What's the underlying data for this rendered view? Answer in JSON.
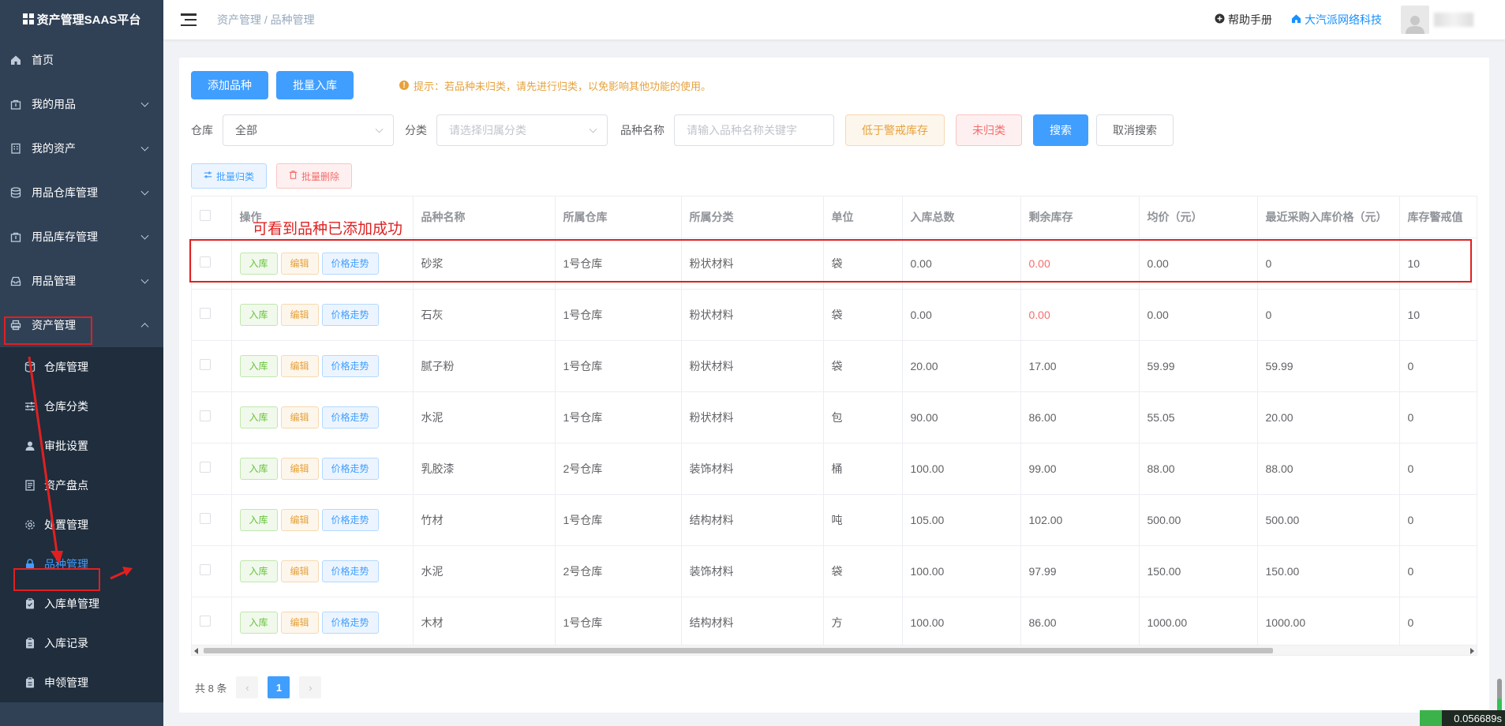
{
  "app": {
    "title": "资产管理SAAS平台"
  },
  "sidebar": {
    "items": [
      {
        "label": "首页",
        "icon": "home-icon"
      },
      {
        "label": "我的用品",
        "icon": "bag-icon"
      },
      {
        "label": "我的资产",
        "icon": "building-icon"
      },
      {
        "label": "用品仓库管理",
        "icon": "database-icon"
      },
      {
        "label": "用品库存管理",
        "icon": "bag-icon"
      },
      {
        "label": "用品管理",
        "icon": "inbox-icon"
      },
      {
        "label": "资产管理",
        "icon": "printer-icon"
      }
    ],
    "sub_items": [
      {
        "label": "仓库管理",
        "icon": "database-icon"
      },
      {
        "label": "仓库分类",
        "icon": "sliders-icon"
      },
      {
        "label": "审批设置",
        "icon": "user-icon"
      },
      {
        "label": "资产盘点",
        "icon": "document-icon"
      },
      {
        "label": "处置管理",
        "icon": "gear-icon"
      },
      {
        "label": "品种管理",
        "icon": "lock-icon"
      },
      {
        "label": "入库单管理",
        "icon": "clipboard-icon"
      },
      {
        "label": "入库记录",
        "icon": "clipboard-icon"
      },
      {
        "label": "申领管理",
        "icon": "clipboard-icon"
      }
    ]
  },
  "header": {
    "breadcrumb_parent": "资产管理",
    "breadcrumb_sep": "/",
    "breadcrumb_current": "品种管理",
    "help_label": "帮助手册",
    "company_label": "大汽派网络科技"
  },
  "toolbar": {
    "add_label": "添加品种",
    "batch_in_label": "批量入库",
    "tip": "提示：若品种未归类，请先进行归类，以免影响其他功能的使用。"
  },
  "filters": {
    "warehouse_label": "仓库",
    "warehouse_value": "全部",
    "category_label": "分类",
    "category_placeholder": "请选择归属分类",
    "name_label": "品种名称",
    "name_placeholder": "请输入品种名称关键字",
    "low_stock_label": "低于警戒库存",
    "uncategorized_label": "未归类",
    "search_label": "搜索",
    "cancel_label": "取消搜索"
  },
  "batch": {
    "classify_label": "批量归类",
    "delete_label": "批量删除"
  },
  "table": {
    "columns": [
      "操作",
      "品种名称",
      "所属仓库",
      "所属分类",
      "单位",
      "入库总数",
      "剩余库存",
      "均价（元）",
      "最近采购入库价格（元）",
      "库存警戒值"
    ],
    "action_labels": {
      "in": "入库",
      "edit": "编辑",
      "trend": "价格走势"
    },
    "rows": [
      {
        "name": "砂浆",
        "warehouse": "1号仓库",
        "category": "粉状材料",
        "unit": "袋",
        "total_in": "0.00",
        "remaining": "0.00",
        "avg_price": "0.00",
        "last_price": "0",
        "warning": "10"
      },
      {
        "name": "石灰",
        "warehouse": "1号仓库",
        "category": "粉状材料",
        "unit": "袋",
        "total_in": "0.00",
        "remaining": "0.00",
        "avg_price": "0.00",
        "last_price": "0",
        "warning": "10"
      },
      {
        "name": "腻子粉",
        "warehouse": "1号仓库",
        "category": "粉状材料",
        "unit": "袋",
        "total_in": "20.00",
        "remaining": "17.00",
        "avg_price": "59.99",
        "last_price": "59.99",
        "warning": "0"
      },
      {
        "name": "水泥",
        "warehouse": "1号仓库",
        "category": "粉状材料",
        "unit": "包",
        "total_in": "90.00",
        "remaining": "86.00",
        "avg_price": "55.05",
        "last_price": "20.00",
        "warning": "0"
      },
      {
        "name": "乳胶漆",
        "warehouse": "2号仓库",
        "category": "装饰材料",
        "unit": "桶",
        "total_in": "100.00",
        "remaining": "99.00",
        "avg_price": "88.00",
        "last_price": "88.00",
        "warning": "0"
      },
      {
        "name": "竹材",
        "warehouse": "1号仓库",
        "category": "结构材料",
        "unit": "吨",
        "total_in": "105.00",
        "remaining": "102.00",
        "avg_price": "500.00",
        "last_price": "500.00",
        "warning": "0"
      },
      {
        "name": "水泥",
        "warehouse": "2号仓库",
        "category": "装饰材料",
        "unit": "袋",
        "total_in": "100.00",
        "remaining": "97.99",
        "avg_price": "150.00",
        "last_price": "150.00",
        "warning": "0"
      },
      {
        "name": "木材",
        "warehouse": "1号仓库",
        "category": "结构材料",
        "unit": "方",
        "total_in": "100.00",
        "remaining": "86.00",
        "avg_price": "1000.00",
        "last_price": "1000.00",
        "warning": "0"
      }
    ]
  },
  "pagination": {
    "total_label": "共 8 条",
    "current_page": "1",
    "prev": "‹",
    "next": "›"
  },
  "annotation": {
    "text": "可看到品种已添加成功"
  },
  "timer": {
    "value": "0.056689s"
  },
  "colors": {
    "sidebar": "#304156",
    "primary": "#409eff",
    "annotation": "#e02020",
    "warning": "#e6a23c",
    "danger": "#f56c6c",
    "success": "#67c23a"
  }
}
